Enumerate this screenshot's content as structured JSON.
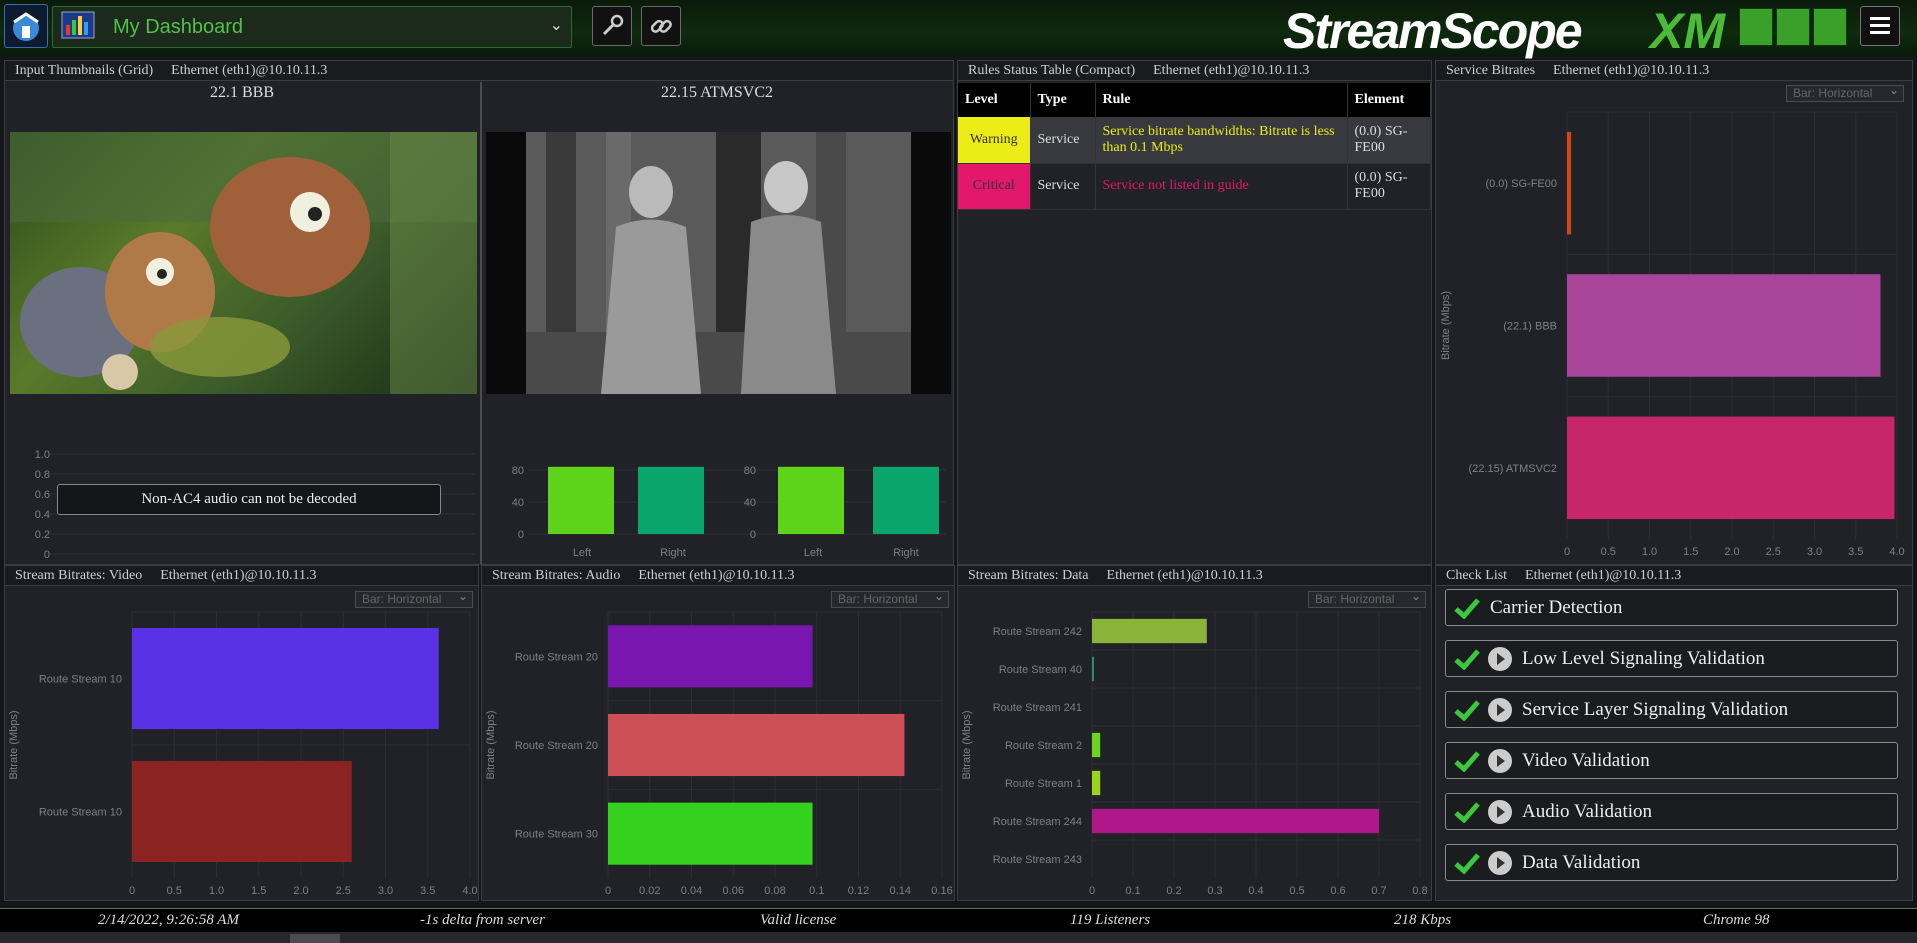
{
  "header": {
    "dashboard_name": "My Dashboard",
    "logo_text": "StreamScope",
    "logo_suffix": "XM",
    "settings_icon": "wrench-icon",
    "link_icon": "link-icon"
  },
  "panels": {
    "thumbnails": {
      "title": "Input Thumbnails (Grid)",
      "source": "Ethernet (eth1)@10.10.11.3",
      "items": [
        {
          "name": "22.1 BBB",
          "audio_message": "Non-AC4 audio can not be decoded",
          "yticks": [
            "1.0",
            "0.8",
            "0.6",
            "0.4",
            "0.2",
            "0"
          ]
        },
        {
          "name": "22.15 ATMSVC2",
          "yticks": [
            "80",
            "40",
            "0"
          ],
          "channels": [
            "Left",
            "Right"
          ]
        }
      ]
    },
    "rules": {
      "title": "Rules Status Table (Compact)",
      "source": "Ethernet (eth1)@10.10.11.3",
      "columns": [
        "Level",
        "Type",
        "Rule",
        "Element"
      ],
      "rows": [
        {
          "level": "Warning",
          "type": "Service",
          "rule": "Service bitrate bandwidths: Bitrate is less than 0.1 Mbps",
          "element": "(0.0) SG-FE00",
          "color": "#ecec17"
        },
        {
          "level": "Critical",
          "type": "Service",
          "rule": "Service not listed in guide",
          "element": "(0.0) SG-FE00",
          "color": "#e3176c"
        }
      ]
    },
    "service_bitrates": {
      "title": "Service Bitrates",
      "source": "Ethernet (eth1)@10.10.11.3",
      "chart_select": "Bar: Horizontal"
    },
    "video": {
      "title": "Stream Bitrates: Video",
      "source": "Ethernet (eth1)@10.10.11.3",
      "chart_select": "Bar: Horizontal"
    },
    "audio": {
      "title": "Stream Bitrates: Audio",
      "source": "Ethernet (eth1)@10.10.11.3",
      "chart_select": "Bar: Horizontal"
    },
    "data": {
      "title": "Stream Bitrates: Data",
      "source": "Ethernet (eth1)@10.10.11.3",
      "chart_select": "Bar: Horizontal"
    },
    "checklist": {
      "title": "Check List",
      "source": "Ethernet (eth1)@10.10.11.3",
      "items": [
        {
          "label": "Carrier Detection",
          "has_play": false
        },
        {
          "label": "Low Level Signaling Validation",
          "has_play": true
        },
        {
          "label": "Service Layer Signaling Validation",
          "has_play": true
        },
        {
          "label": "Video Validation",
          "has_play": true
        },
        {
          "label": "Audio Validation",
          "has_play": true
        },
        {
          "label": "Data Validation",
          "has_play": true
        }
      ]
    }
  },
  "chart_data": [
    {
      "id": "service",
      "type": "bar",
      "orientation": "horizontal",
      "ylabel": "Bitrate (Mbps)",
      "categories": [
        "(0.0) SG-FE00",
        "(22.1) BBB",
        "(22.15) ATMSVC2"
      ],
      "values": [
        0.05,
        3.8,
        3.97
      ],
      "colors": [
        "#d2451e",
        "#a8459a",
        "#c8266a"
      ],
      "xticks": [
        0,
        0.5,
        1.0,
        1.5,
        2.0,
        2.5,
        3.0,
        3.5,
        4.0
      ],
      "xlim": [
        0,
        4.0
      ]
    },
    {
      "id": "video",
      "type": "bar",
      "orientation": "horizontal",
      "ylabel": "Bitrate (Mbps)",
      "categories": [
        "Route Stream 10",
        "Route Stream 10"
      ],
      "values": [
        3.63,
        2.6
      ],
      "colors": [
        "#5932e6",
        "#8c2323"
      ],
      "xticks": [
        0,
        0.5,
        1.0,
        1.5,
        2.0,
        2.5,
        3.0,
        3.5,
        4.0
      ],
      "xlim": [
        0,
        4.0
      ]
    },
    {
      "id": "audio",
      "type": "bar",
      "orientation": "horizontal",
      "ylabel": "Bitrate (Mbps)",
      "categories": [
        "Route Stream 20",
        "Route Stream 20",
        "Route Stream 30"
      ],
      "values": [
        0.098,
        0.142,
        0.098
      ],
      "colors": [
        "#7a16b0",
        "#cc4f55",
        "#34d21e"
      ],
      "xticks": [
        0,
        0.02,
        0.04,
        0.06,
        0.08,
        0.1,
        0.12,
        0.14,
        0.16
      ],
      "xlim": [
        0,
        0.16
      ]
    },
    {
      "id": "data",
      "type": "bar",
      "orientation": "horizontal",
      "ylabel": "Bitrate (Mbps)",
      "categories": [
        "Route Stream 242",
        "Route Stream 40",
        "Route Stream 241",
        "Route Stream 2",
        "Route Stream 1",
        "Route Stream 244",
        "Route Stream 243"
      ],
      "values": [
        0.28,
        0.004,
        0,
        0.02,
        0.02,
        0.7,
        0
      ],
      "colors": [
        "#8ab33a",
        "#2a8a7a",
        "#888888",
        "#6cd31e",
        "#9ad31e",
        "#b0178a",
        "#888888"
      ],
      "xticks": [
        0,
        0.1,
        0.2,
        0.3,
        0.4,
        0.5,
        0.6,
        0.7,
        0.8
      ],
      "xlim": [
        0,
        0.8
      ]
    },
    {
      "id": "audio-levels",
      "type": "bar",
      "orientation": "vertical",
      "categories": [
        "Left",
        "Right",
        "Left",
        "Right"
      ],
      "values": [
        85,
        85,
        85,
        85
      ],
      "colors": [
        "#5dd41a",
        "#0aa56a",
        "#5dd41a",
        "#0aa56a"
      ],
      "ylim": [
        0,
        80
      ]
    }
  ],
  "status": {
    "datetime": "2/14/2022, 9:26:58 AM",
    "delta": "-1s delta from server",
    "license": "Valid license",
    "listeners": "119 Listeners",
    "rate": "218 Kbps",
    "browser": "Chrome 98"
  }
}
